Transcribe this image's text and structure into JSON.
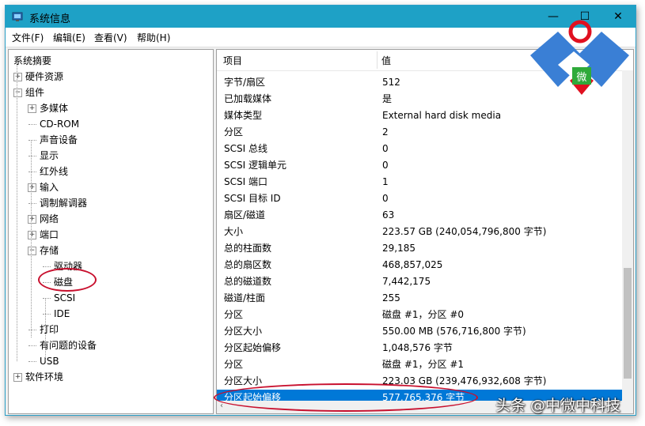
{
  "window": {
    "title": "系统信息"
  },
  "menu": [
    "文件(F)",
    "编辑(E)",
    "查看(V)",
    "帮助(H)"
  ],
  "tree": [
    {
      "label": "系统摘要",
      "level": 0,
      "expander": ""
    },
    {
      "label": "硬件资源",
      "level": 1,
      "expander": "+"
    },
    {
      "label": "组件",
      "level": 1,
      "expander": "-"
    },
    {
      "label": "多媒体",
      "level": 2,
      "expander": "+"
    },
    {
      "label": "CD-ROM",
      "level": 2,
      "expander": ""
    },
    {
      "label": "声音设备",
      "level": 2,
      "expander": ""
    },
    {
      "label": "显示",
      "level": 2,
      "expander": ""
    },
    {
      "label": "红外线",
      "level": 2,
      "expander": ""
    },
    {
      "label": "输入",
      "level": 2,
      "expander": "+"
    },
    {
      "label": "调制解调器",
      "level": 2,
      "expander": ""
    },
    {
      "label": "网络",
      "level": 2,
      "expander": "+"
    },
    {
      "label": "端口",
      "level": 2,
      "expander": "+"
    },
    {
      "label": "存储",
      "level": 2,
      "expander": "-"
    },
    {
      "label": "驱动器",
      "level": 3,
      "expander": ""
    },
    {
      "label": "磁盘",
      "level": 3,
      "expander": ""
    },
    {
      "label": "SCSI",
      "level": 3,
      "expander": ""
    },
    {
      "label": "IDE",
      "level": 3,
      "expander": ""
    },
    {
      "label": "打印",
      "level": 2,
      "expander": ""
    },
    {
      "label": "有问题的设备",
      "level": 2,
      "expander": ""
    },
    {
      "label": "USB",
      "level": 2,
      "expander": ""
    },
    {
      "label": "软件环境",
      "level": 1,
      "expander": "+"
    }
  ],
  "table": {
    "headers": [
      "项目",
      "值"
    ],
    "rows": [
      [
        "字节/扇区",
        "512"
      ],
      [
        "已加载媒体",
        "是"
      ],
      [
        "媒体类型",
        "External hard disk media"
      ],
      [
        "分区",
        "2"
      ],
      [
        "SCSI 总线",
        "0"
      ],
      [
        "SCSI 逻辑单元",
        "0"
      ],
      [
        "SCSI 端口",
        "1"
      ],
      [
        "SCSI 目标 ID",
        "0"
      ],
      [
        "扇区/磁道",
        "63"
      ],
      [
        "大小",
        "223.57 GB (240,054,796,800 字节)"
      ],
      [
        "总的柱面数",
        "29,185"
      ],
      [
        "总的扇区数",
        "468,857,025"
      ],
      [
        "总的磁道数",
        "7,442,175"
      ],
      [
        "磁道/柱面",
        "255"
      ],
      [
        "分区",
        "磁盘 #1，分区 #0"
      ],
      [
        "分区大小",
        "550.00 MB (576,716,800 字节)"
      ],
      [
        "分区起始偏移",
        "1,048,576 字节"
      ],
      [
        "分区",
        "磁盘 #1，分区 #1"
      ],
      [
        "分区大小",
        "223.03 GB (239,476,932,608 字节)"
      ],
      [
        "分区起始偏移",
        "577,765,376 字节"
      ]
    ],
    "selected_row": 19
  },
  "logo": {
    "char": "微"
  },
  "watermark": "头条 @中微中科技",
  "colors": {
    "titlebar": "#1ea1c6",
    "selection": "#0078d7",
    "highlight_ellipse": "#c8102e",
    "logo_blue": "#3a7fd5",
    "logo_red": "#e01020"
  }
}
